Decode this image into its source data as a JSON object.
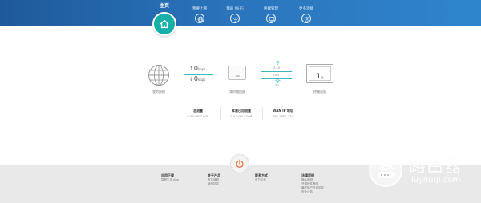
{
  "header": {
    "home_label": "主页",
    "nav": [
      {
        "label": "我要上网",
        "icon": "globe-icon"
      },
      {
        "label": "我的 Wi-Fi",
        "icon": "wifi-icon"
      },
      {
        "label": "终端管理",
        "icon": "device-icon"
      },
      {
        "label": "更多功能",
        "icon": "settings-icon"
      }
    ]
  },
  "topology": {
    "internet_label": "我的网络",
    "upload_speed": "0",
    "download_speed": "0",
    "speed_unit": "kbps",
    "router_label": "我的路由器",
    "bands": [
      "2.4G",
      "LAN",
      "5G"
    ],
    "device_count": "1",
    "device_unit": "台",
    "devices_label": "终端设备"
  },
  "info": [
    {
      "title": "总流量",
      "value": "0.0.0 GB 7.0GB"
    },
    {
      "title": "本周已用流量",
      "value": "0.0.0 GB 7.0GB"
    },
    {
      "title": "WAN IP 地址",
      "value": "192.168.1.254"
    }
  ],
  "footer": {
    "columns": [
      {
        "title": "应用下载",
        "links": [
          "智慧生活 App"
        ]
      },
      {
        "title": "关于产品",
        "links": [
          "官方商城",
          "使用协议"
        ]
      },
      {
        "title": "联系方式",
        "links": [
          "官方论坛"
        ]
      },
      {
        "title": "法律声明",
        "links": [
          "隐私声明",
          "开源软件声明",
          "最终用户许可协议",
          "安全公告"
        ]
      }
    ]
  },
  "watermark": {
    "cn": "路由器",
    "en": "luyouqi.com"
  },
  "colors": {
    "header": "#2a75bd",
    "accent": "#16b0a8",
    "power": "#f0703a",
    "footer": "#e9e9e9"
  }
}
